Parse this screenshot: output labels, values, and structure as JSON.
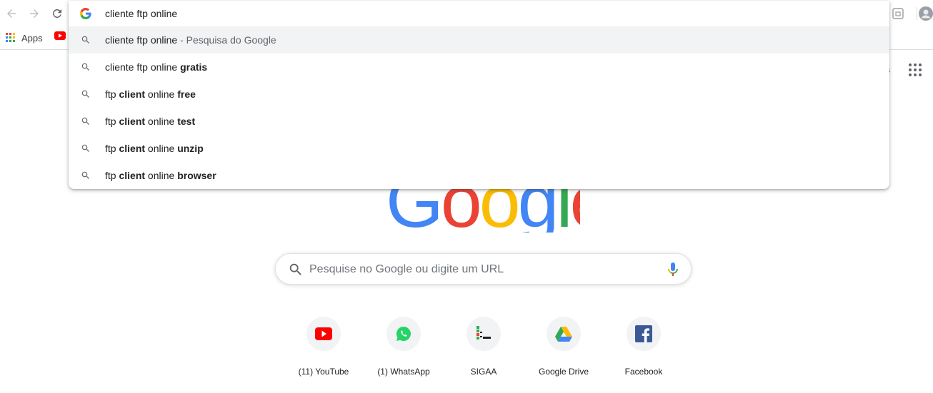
{
  "browser": {
    "bookmarks": {
      "apps_label": "Apps"
    }
  },
  "omnibox": {
    "input_value": "cliente ftp online",
    "suggestions": [
      {
        "parts": [
          {
            "t": "cliente ftp online",
            "b": false
          }
        ],
        "suffix": " - Pesquisa do Google",
        "selected": true
      },
      {
        "parts": [
          {
            "t": "cliente ftp online ",
            "b": false
          },
          {
            "t": "gratis",
            "b": true
          }
        ]
      },
      {
        "parts": [
          {
            "t": "ftp ",
            "b": false
          },
          {
            "t": "client",
            "b": true
          },
          {
            "t": " online ",
            "b": false
          },
          {
            "t": "free",
            "b": true
          }
        ]
      },
      {
        "parts": [
          {
            "t": "ftp ",
            "b": false
          },
          {
            "t": "client",
            "b": true
          },
          {
            "t": " online ",
            "b": false
          },
          {
            "t": "test",
            "b": true
          }
        ]
      },
      {
        "parts": [
          {
            "t": "ftp ",
            "b": false
          },
          {
            "t": "client",
            "b": true
          },
          {
            "t": " online ",
            "b": false
          },
          {
            "t": "unzip",
            "b": true
          }
        ]
      },
      {
        "parts": [
          {
            "t": "ftp ",
            "b": false
          },
          {
            "t": "client",
            "b": true
          },
          {
            "t": " online ",
            "b": false
          },
          {
            "t": "browser",
            "b": true
          }
        ]
      }
    ]
  },
  "page": {
    "logo_text": "Google",
    "search_placeholder": "Pesquise no Google ou digite um URL",
    "shortcuts": [
      {
        "label": "(11) YouTube",
        "icon": "youtube-icon"
      },
      {
        "label": "(1) WhatsApp",
        "icon": "whatsapp-icon"
      },
      {
        "label": "SIGAA",
        "icon": "sigaa-icon"
      },
      {
        "label": "Google Drive",
        "icon": "google-drive-icon"
      },
      {
        "label": "Facebook",
        "icon": "facebook-icon"
      }
    ]
  },
  "colors": {
    "google_blue": "#4285F4",
    "google_red": "#EA4335",
    "google_yellow": "#FBBC05",
    "google_green": "#34A853",
    "selected_row": "#f1f3f4"
  }
}
